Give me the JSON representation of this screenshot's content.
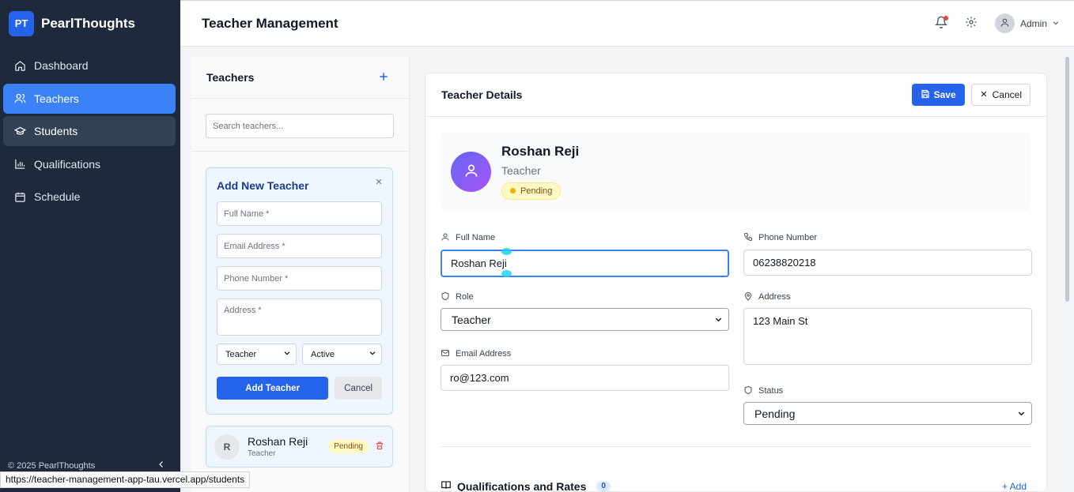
{
  "brand": {
    "logo": "PT",
    "name": "PearlThoughts"
  },
  "nav": [
    {
      "label": "Dashboard",
      "icon": "home-icon"
    },
    {
      "label": "Teachers",
      "icon": "users-icon"
    },
    {
      "label": "Students",
      "icon": "graduation-cap-icon"
    },
    {
      "label": "Qualifications",
      "icon": "bar-chart-icon"
    },
    {
      "label": "Schedule",
      "icon": "calendar-icon"
    }
  ],
  "footer": {
    "copyright": "© 2025 PearlThoughts"
  },
  "status_url": "https://teacher-management-app-tau.vercel.app/students",
  "header": {
    "title": "Teacher Management",
    "user": "Admin"
  },
  "list_panel": {
    "title": "Teachers",
    "search_placeholder": "Search teachers...",
    "add_form": {
      "title": "Add New Teacher",
      "full_name_placeholder": "Full Name *",
      "email_placeholder": "Email Address *",
      "phone_placeholder": "Phone Number *",
      "address_placeholder": "Address *",
      "role_value": "Teacher",
      "status_value": "Active",
      "submit_label": "Add Teacher",
      "cancel_label": "Cancel"
    },
    "teachers": [
      {
        "initial": "R",
        "name": "Roshan Reji",
        "role": "Teacher",
        "status": "Pending"
      }
    ]
  },
  "details": {
    "title": "Teacher Details",
    "save_label": "Save",
    "cancel_label": "Cancel",
    "profile": {
      "name": "Roshan Reji",
      "role": "Teacher",
      "status": "Pending"
    },
    "fields": {
      "full_name_label": "Full Name",
      "full_name_value": "Roshan Reji",
      "phone_label": "Phone Number",
      "phone_value": "06238820218",
      "role_label": "Role",
      "role_value": "Teacher",
      "address_label": "Address",
      "address_value": "123 Main St",
      "email_label": "Email Address",
      "email_value": "ro@123.com",
      "status_label": "Status",
      "status_value": "Pending"
    },
    "qualifications": {
      "title": "Qualifications and Rates",
      "count": "0",
      "add_label": "+ Add"
    }
  },
  "colors": {
    "sidebar": "#1e293b",
    "accent": "#2563eb",
    "pending_bg": "#fef9c3"
  }
}
